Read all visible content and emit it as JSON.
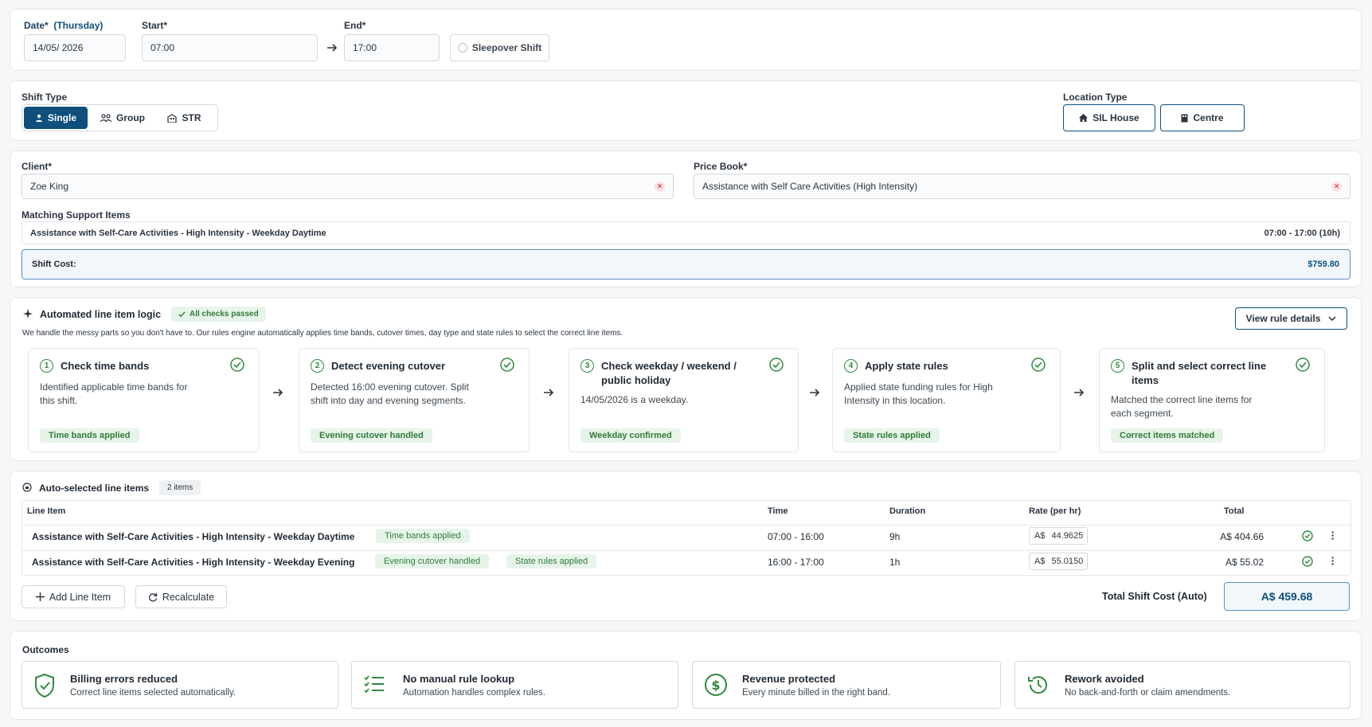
{
  "datetime": {
    "date_label": "Date*",
    "day_label": "(Thursday)",
    "date_value": "14/05/ 2026",
    "start_label": "Start*",
    "start_value": "07:00",
    "end_label": "End*",
    "end_value": "17:00",
    "sleepover_label": "Sleepover Shift"
  },
  "shift_type": {
    "label": "Shift Type",
    "options": [
      "Single",
      "Group",
      "STR"
    ],
    "selected": "Single"
  },
  "location_type": {
    "label": "Location Type",
    "options": [
      "SIL House",
      "Centre"
    ]
  },
  "client": {
    "label": "Client*",
    "value": "Zoe King",
    "price_book_label": "Price Book*",
    "price_book_value": "Assistance with Self Care Activities (High Intensity)",
    "matching_label": "Matching Support Items",
    "matching_item": "Assistance with Self-Care Activities - High Intensity - Weekday Daytime",
    "matching_time": "07:00 - 17:00 (10h)",
    "shift_cost_label": "Shift Cost:",
    "shift_cost_value": "$759.80"
  },
  "logic": {
    "title": "Automated line item logic",
    "badge": "All checks passed",
    "description": "We handle the messy parts so you don't have to. Our rules engine automatically applies time bands, cutover times, day type and state rules to select the correct line items.",
    "view_button": "View rule details",
    "steps": [
      {
        "num": "1",
        "title": "Check time bands",
        "desc": "Identified applicable time bands for this shift.",
        "pill": "Time bands applied"
      },
      {
        "num": "2",
        "title": "Detect evening cutover",
        "desc": "Detected 16:00 evening cutover. Split shift into day and evening segments.",
        "pill": "Evening cutover handled"
      },
      {
        "num": "3",
        "title": "Check weekday / weekend / public holiday",
        "desc": "14/05/2026 is a weekday.",
        "pill": "Weekday confirmed"
      },
      {
        "num": "4",
        "title": "Apply state rules",
        "desc": "Applied state funding rules for High Intensity in this location.",
        "pill": "State rules applied"
      },
      {
        "num": "5",
        "title": "Split and select correct line items",
        "desc": "Matched the correct line items for each segment.",
        "pill": "Correct items matched"
      }
    ]
  },
  "line_items": {
    "title": "Auto-selected line items",
    "count": "2 items",
    "headers": [
      "Line Item",
      "Time",
      "Duration",
      "Rate (per hr)",
      "Total"
    ],
    "rows": [
      {
        "name": "Assistance with Self-Care Activities - High Intensity - Weekday Daytime",
        "tags": [
          "Time bands applied"
        ],
        "time": "07:00 - 16:00",
        "duration": "9h",
        "currency": "A$",
        "rate": "44.9625",
        "total": "A$ 404.66"
      },
      {
        "name": "Assistance with Self-Care Activities - High Intensity - Weekday Evening",
        "tags": [
          "Evening cutover handled",
          "State rules applied"
        ],
        "time": "16:00 - 17:00",
        "duration": "1h",
        "currency": "A$",
        "rate": "55.0150",
        "total": "A$ 55.02"
      }
    ],
    "add_button": "Add Line Item",
    "recalc_button": "Recalculate",
    "total_label": "Total Shift Cost (Auto)",
    "total_value": "A$ 459.68"
  },
  "outcomes": {
    "title": "Outcomes",
    "items": [
      {
        "icon": "shield-check-icon",
        "title": "Billing errors reduced",
        "desc": "Correct line items selected automatically."
      },
      {
        "icon": "list-check-icon",
        "title": "No manual rule lookup",
        "desc": "Automation handles complex rules."
      },
      {
        "icon": "dollar-circle-icon",
        "title": "Revenue protected",
        "desc": "Every minute billed in the right band."
      },
      {
        "icon": "history-icon",
        "title": "Rework avoided",
        "desc": "No back-and-forth or claim amendments."
      }
    ]
  },
  "colors": {
    "primary": "#0e4f7c",
    "success": "#2f8a3e",
    "success_bg": "#e7f4e9"
  }
}
